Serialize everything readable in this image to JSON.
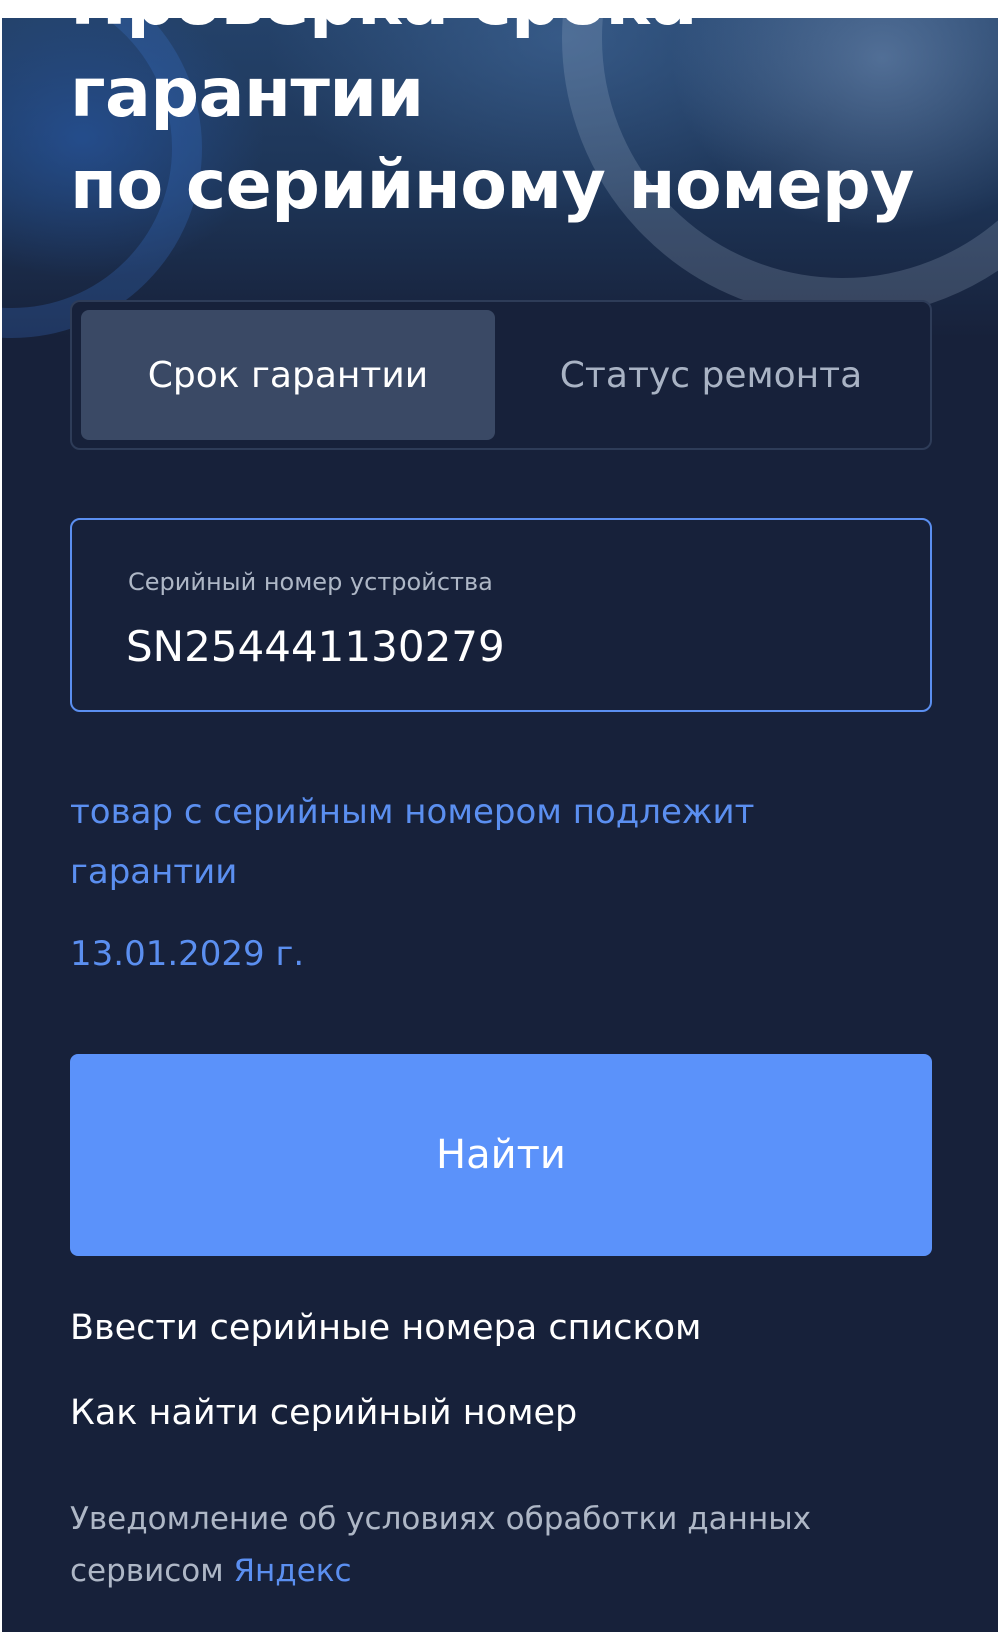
{
  "hero": {
    "title_line_1": "Проверка срока",
    "title_line_2": "гарантии",
    "title_line_3": "по серийному номеру"
  },
  "tabs": [
    {
      "label": "Срок гарантии",
      "active": true
    },
    {
      "label": "Статус ремонта",
      "active": false
    }
  ],
  "serial_field": {
    "label": "Серийный номер устройства",
    "value": "SN254441130279"
  },
  "result": {
    "message": "товар с серийным номером подлежит гарантии",
    "date": "13.01.2029 г."
  },
  "actions": {
    "find_label": "Найти",
    "bulk_link": "Ввести серийные номера списком",
    "howto_link": "Как найти серийный номер"
  },
  "notice": {
    "text": "Уведомление об условиях обработки данных сервисом",
    "link": "Яндекс"
  },
  "colors": {
    "background": "#17213a",
    "accent": "#5b92fa",
    "link_blue": "#5b8ff0",
    "tab_active": "#3a4965"
  }
}
